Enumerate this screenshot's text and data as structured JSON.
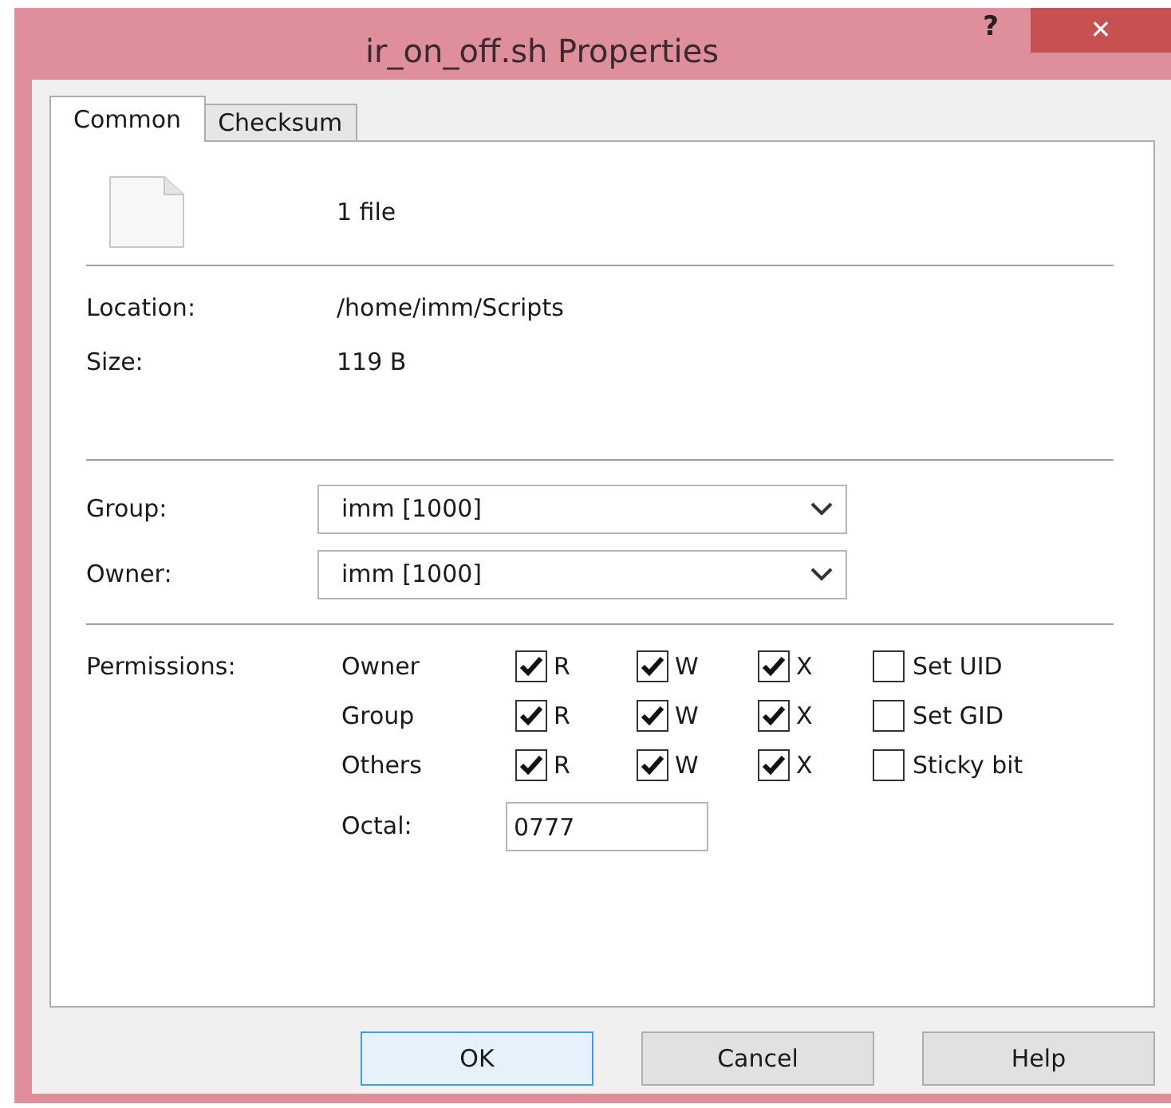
{
  "window": {
    "title": "ir_on_off.sh Properties",
    "help_glyph": "?",
    "close_glyph": "✕"
  },
  "tabs": [
    {
      "label": "Common",
      "selected": true
    },
    {
      "label": "Checksum",
      "selected": false
    }
  ],
  "summary": "1 file",
  "info": [
    {
      "label": "Location:",
      "value": "/home/imm/Scripts"
    },
    {
      "label": "Size:",
      "value": "119 B"
    }
  ],
  "combos": [
    {
      "label": "Group:",
      "value": "imm [1000]"
    },
    {
      "label": "Owner:",
      "value": "imm [1000]"
    }
  ],
  "permissions": {
    "label": "Permissions:",
    "rows": [
      {
        "name": "Owner",
        "bits": [
          {
            "label": "R",
            "checked": true
          },
          {
            "label": "W",
            "checked": true
          },
          {
            "label": "X",
            "checked": true
          }
        ],
        "special": {
          "label": "Set UID",
          "checked": false
        }
      },
      {
        "name": "Group",
        "bits": [
          {
            "label": "R",
            "checked": true
          },
          {
            "label": "W",
            "checked": true
          },
          {
            "label": "X",
            "checked": true
          }
        ],
        "special": {
          "label": "Set GID",
          "checked": false
        }
      },
      {
        "name": "Others",
        "bits": [
          {
            "label": "R",
            "checked": true
          },
          {
            "label": "W",
            "checked": true
          },
          {
            "label": "X",
            "checked": true
          }
        ],
        "special": {
          "label": "Sticky bit",
          "checked": false
        }
      }
    ],
    "octal": {
      "label": "Octal:",
      "value": "0777"
    }
  },
  "buttons": [
    {
      "label": "OK",
      "selected": true
    },
    {
      "label": "Cancel",
      "selected": false
    },
    {
      "label": "Help",
      "selected": false
    }
  ]
}
